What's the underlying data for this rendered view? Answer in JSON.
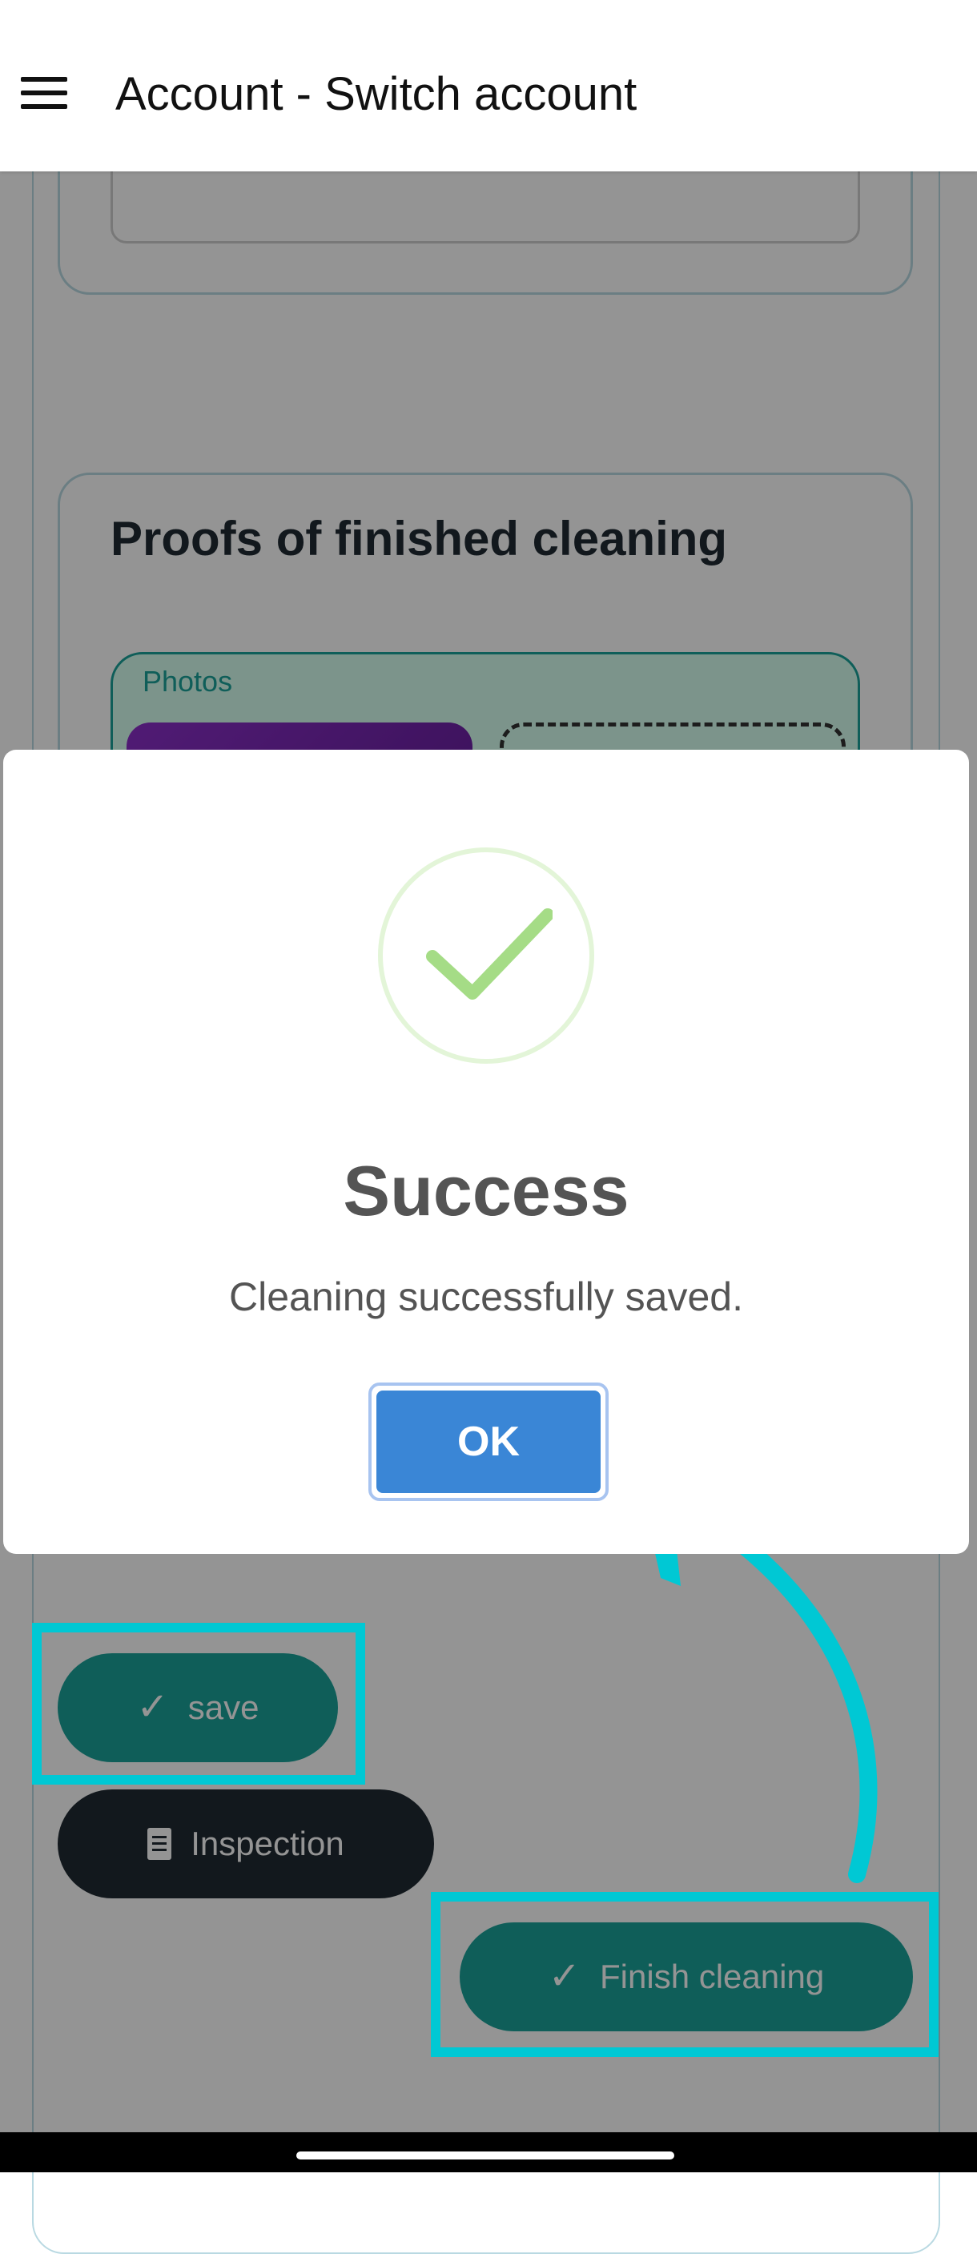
{
  "appbar": {
    "title": "Account - Switch account",
    "menu_icon": "hamburger-menu-icon"
  },
  "background": {
    "proofs_title": "Proofs of finished cleaning",
    "photos_label": "Photos",
    "buttons": {
      "save_label": "save",
      "inspection_label": "Inspection",
      "finish_label": "Finish cleaning"
    }
  },
  "dialog": {
    "icon": "success-check-icon",
    "title": "Success",
    "message": "Cleaning successfully saved.",
    "ok_label": "OK"
  },
  "colors": {
    "accent_teal": "#1aa39a",
    "dark_button": "#1f2a33",
    "ok_blue": "#3a86d6",
    "highlight_cyan": "#00c8d4",
    "success_green": "#a5dc86"
  }
}
